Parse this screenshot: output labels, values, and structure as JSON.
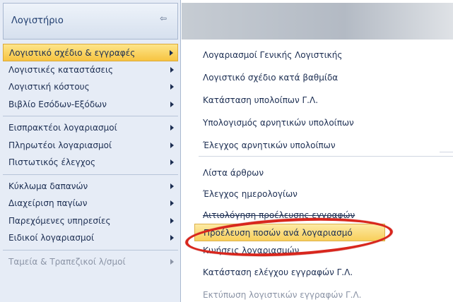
{
  "sidebar": {
    "title": "Λογιστήριο",
    "pin_icon": "pin-icon",
    "items": [
      {
        "label": "Λογιστικό σχέδιο & εγγραφές",
        "active": true
      },
      {
        "label": "Λογιστικές καταστάσεις"
      },
      {
        "label": "Λογιστική κόστους"
      },
      {
        "label": "Βιβλίο Εσόδων-Εξόδων"
      },
      {
        "label": "Εισπρακτέοι λογαριασμοί"
      },
      {
        "label": "Πληρωτέοι λογαριασμοί"
      },
      {
        "label": "Πιστωτικός έλεγχος"
      },
      {
        "label": "Κύκλωμα δαπανών"
      },
      {
        "label": "Διαχείριση παγίων"
      },
      {
        "label": "Παρεχόμενες υπηρεσίες"
      },
      {
        "label": "Ειδικοί λογαριασμοί"
      },
      {
        "label": "Ταμεία & Τραπεζικοί λ/σμοί",
        "disabled": true
      }
    ]
  },
  "submenu": {
    "items": [
      {
        "label": "Λογαριασμοί Γενικής Λογιστικής"
      },
      {
        "label": "Λογιστικό σχέδιο κατά βαθμίδα"
      },
      {
        "label": "Κατάσταση υπολοίπων Γ.Λ."
      },
      {
        "label": "Υπολογισμός αρνητικών υπολοίπων"
      },
      {
        "label": "Έλεγχος αρνητικών υπολοίπων"
      },
      {
        "label": "Λίστα άρθρων"
      },
      {
        "label": "Έλεγχος ημερολογίων"
      },
      {
        "label": "Αιτιολόγηση προέλευσης εγγραφών"
      },
      {
        "label": "Προέλευση ποσών ανά λογαριασμό",
        "highlighted": true
      },
      {
        "label": "Κινήσεις λογαριασμών"
      },
      {
        "label": "Κατάσταση ελέγχου εγγραφών Γ.Λ."
      },
      {
        "label": "Εκτύπωση λογιστικών εγγραφών Γ.Λ.",
        "disabled": true
      }
    ]
  },
  "colors": {
    "highlight": "#f8cf5b",
    "annotation_ring": "#d8261d",
    "sidebar_bg": "#e6ecf6"
  }
}
